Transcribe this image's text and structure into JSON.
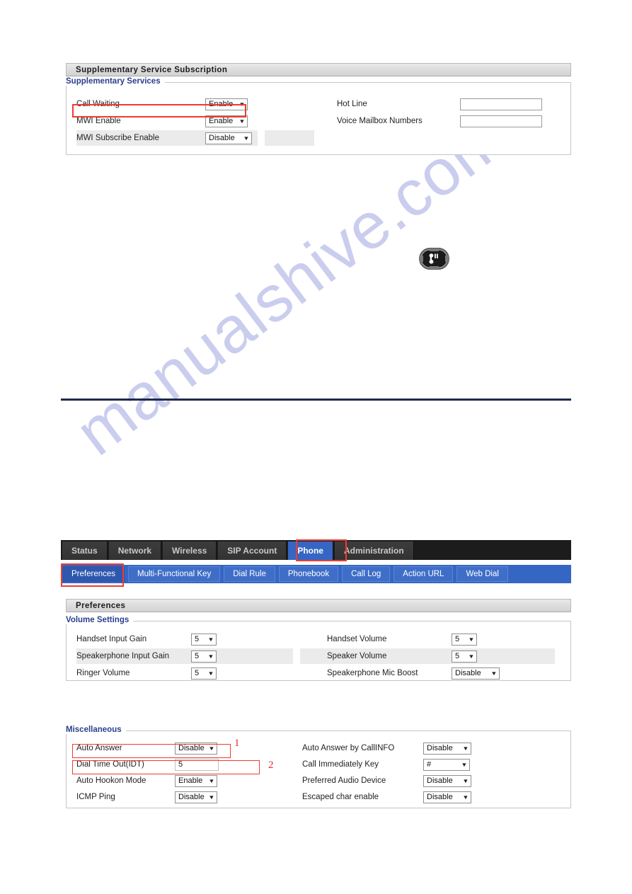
{
  "watermark": {
    "text": "manualshive.com"
  },
  "supplementary_panel": {
    "title": "Supplementary Service Subscription",
    "legend": "Supplementary Services",
    "left_rows": [
      {
        "label": "Call Waiting",
        "control": "select",
        "value": "Enable",
        "highlighted": true,
        "shaded": false
      },
      {
        "label": "MWI Enable",
        "control": "select",
        "value": "Enable",
        "highlighted": false,
        "shaded": false
      },
      {
        "label": "MWI Subscribe Enable",
        "control": "select",
        "value": "Disable",
        "highlighted": false,
        "shaded": true
      }
    ],
    "right_rows": [
      {
        "label": "Hot Line",
        "control": "text",
        "value": ""
      },
      {
        "label": "Voice Mailbox Numbers",
        "control": "text",
        "value": ""
      }
    ]
  },
  "handset_icon": {
    "name": "handset-speaker-button-icon"
  },
  "navigation": {
    "main_tabs": [
      {
        "label": "Status",
        "active": false
      },
      {
        "label": "Network",
        "active": false
      },
      {
        "label": "Wireless",
        "active": false
      },
      {
        "label": "SIP Account",
        "active": false
      },
      {
        "label": "Phone",
        "active": true
      },
      {
        "label": "Administration",
        "active": false
      }
    ],
    "sub_tabs": [
      {
        "label": "Preferences",
        "active": true
      },
      {
        "label": "Multi-Functional Key",
        "active": false
      },
      {
        "label": "Dial Rule",
        "active": false
      },
      {
        "label": "Phonebook",
        "active": false
      },
      {
        "label": "Call Log",
        "active": false
      },
      {
        "label": "Action URL",
        "active": false
      },
      {
        "label": "Web Dial",
        "active": false
      }
    ]
  },
  "preferences_panel": {
    "title": "Preferences",
    "volume": {
      "legend": "Volume Settings",
      "left_rows": [
        {
          "label": "Handset Input Gain",
          "control": "select",
          "value": "5",
          "size": "w-sm",
          "shaded": false
        },
        {
          "label": "Speakerphone Input Gain",
          "control": "select",
          "value": "5",
          "size": "w-sm",
          "shaded": true
        },
        {
          "label": "Ringer Volume",
          "control": "select",
          "value": "5",
          "size": "w-sm",
          "shaded": false
        }
      ],
      "right_rows": [
        {
          "label": "Handset Volume",
          "control": "select",
          "value": "5",
          "size": "w-sm",
          "shaded": false
        },
        {
          "label": "Speaker Volume",
          "control": "select",
          "value": "5",
          "size": "w-sm",
          "shaded": true
        },
        {
          "label": "Speakerphone Mic Boost",
          "control": "select",
          "value": "Disable",
          "size": "w-lg",
          "shaded": false
        }
      ]
    },
    "misc": {
      "legend": "Miscellaneous",
      "left_rows": [
        {
          "label": "Auto Answer",
          "control": "select",
          "value": "Disable",
          "size": "w-md",
          "highlighted": true,
          "annotation": "1"
        },
        {
          "label": "Dial Time Out(IDT)",
          "control": "text",
          "value": "5",
          "size": "w-md",
          "highlighted": true,
          "annotation": "2"
        },
        {
          "label": "Auto Hookon Mode",
          "control": "select",
          "value": "Enable",
          "size": "w-md",
          "highlighted": false,
          "annotation": ""
        },
        {
          "label": "ICMP Ping",
          "control": "select",
          "value": "Disable",
          "size": "w-md",
          "highlighted": false,
          "annotation": ""
        }
      ],
      "right_rows": [
        {
          "label": "Auto Answer by CallINFO",
          "control": "select",
          "value": "Disable",
          "size": "w-lg"
        },
        {
          "label": "Call Immediately Key",
          "control": "select",
          "value": "#",
          "size": "w-key"
        },
        {
          "label": "Preferred Audio Device",
          "control": "select",
          "value": "Disable",
          "size": "w-lg"
        },
        {
          "label": "Escaped char enable",
          "control": "select",
          "value": "Disable",
          "size": "w-lg"
        }
      ]
    }
  },
  "colors": {
    "accent_blue": "#3566c4",
    "legend_blue": "#2b3f8c",
    "highlight_red": "#ef3b30",
    "divider_navy": "#1c2a4a",
    "watermark": "#c8cbee"
  }
}
